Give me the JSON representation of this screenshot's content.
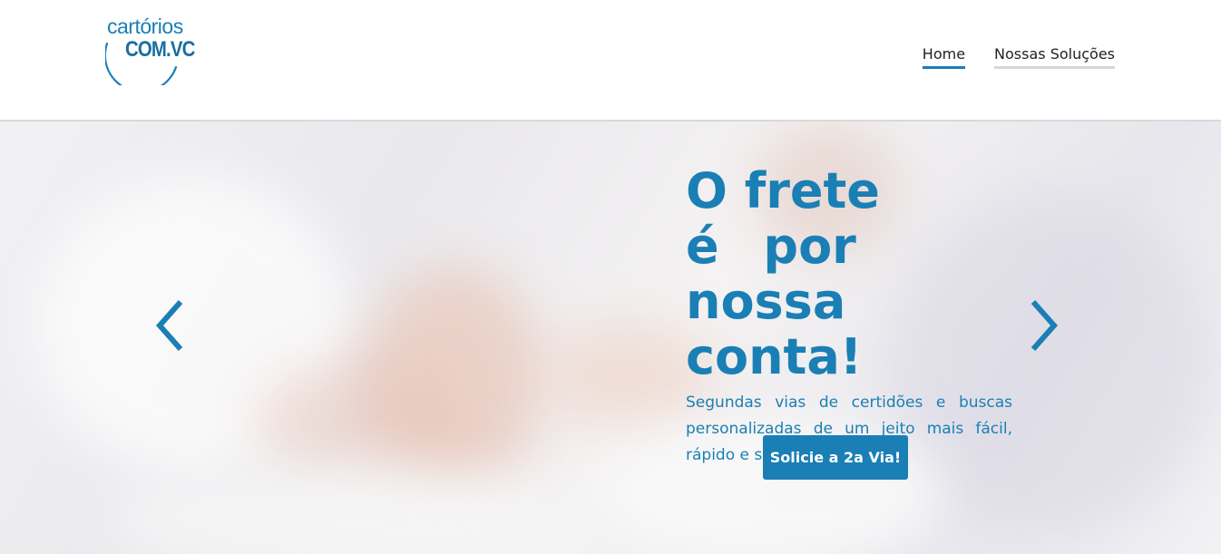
{
  "header": {
    "logo": {
      "line1": "cartórios",
      "line2": "COM.VC"
    },
    "nav": [
      {
        "label": "Home"
      },
      {
        "label": "Nossas Soluções"
      }
    ]
  },
  "hero": {
    "headline": {
      "line1": "O frete",
      "line2": "é por nossa",
      "line3": "conta!"
    },
    "subtext": "Segundas vias de certidões e buscas personalizadas de um jeito mais fácil, rápido e seguro.",
    "cta_label": "Solicie a 2a Via!",
    "prev_icon": "chevron-left-icon",
    "next_icon": "chevron-right-icon"
  },
  "colors": {
    "brand": "#1a7fb5",
    "nav_text": "#222222",
    "nav_underline_inactive": "#d6d6d6"
  }
}
